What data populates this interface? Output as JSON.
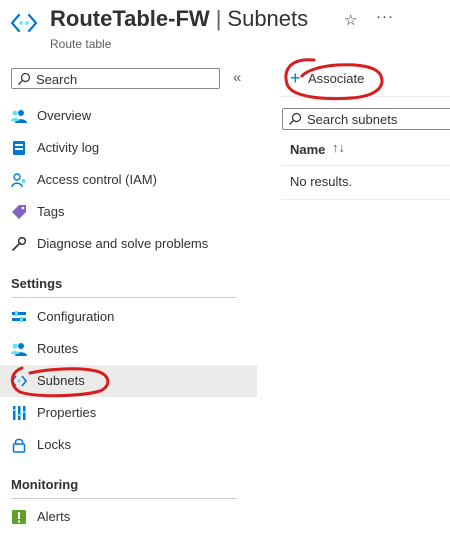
{
  "header": {
    "resource_name": "RouteTable-FW",
    "separator": "|",
    "page_name": "Subnets",
    "subtitle": "Route table",
    "favorite_icon": "star-outline-icon",
    "more_icon": "ellipsis-icon"
  },
  "sidebar": {
    "search_placeholder": "Search",
    "items_top": [
      {
        "label": "Overview",
        "icon": "overview-icon"
      },
      {
        "label": "Activity log",
        "icon": "activity-log-icon"
      },
      {
        "label": "Access control (IAM)",
        "icon": "iam-icon"
      },
      {
        "label": "Tags",
        "icon": "tag-icon"
      },
      {
        "label": "Diagnose and solve problems",
        "icon": "wrench-icon"
      }
    ],
    "settings_header": "Settings",
    "items_settings": [
      {
        "label": "Configuration",
        "icon": "configuration-icon"
      },
      {
        "label": "Routes",
        "icon": "routes-icon"
      },
      {
        "label": "Subnets",
        "icon": "subnets-icon",
        "active": true
      },
      {
        "label": "Properties",
        "icon": "properties-icon"
      },
      {
        "label": "Locks",
        "icon": "lock-icon"
      }
    ],
    "monitoring_header": "Monitoring",
    "items_monitoring": [
      {
        "label": "Alerts",
        "icon": "alerts-icon"
      }
    ]
  },
  "toolbar": {
    "associate_label": "Associate"
  },
  "main": {
    "search_placeholder": "Search subnets",
    "column_name": "Name",
    "empty_text": "No results."
  },
  "colors": {
    "accent": "#0078d4",
    "annotation": "#d91c1c",
    "active_bg": "#edebe9"
  }
}
